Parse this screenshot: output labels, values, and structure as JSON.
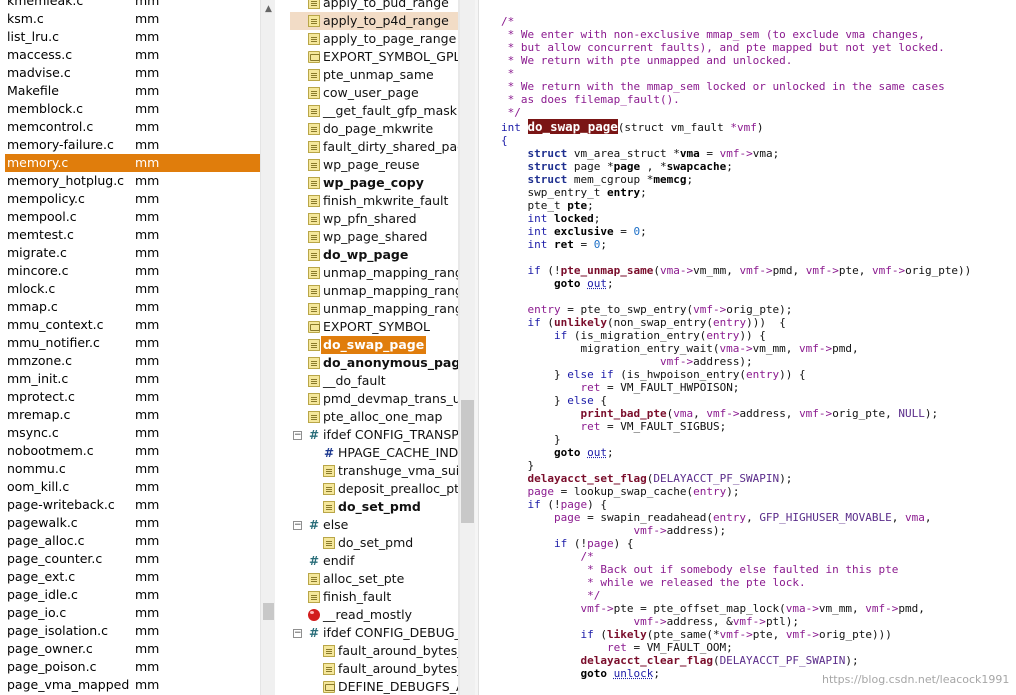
{
  "files": [
    {
      "name": "kmemleak.c",
      "dir": "mm",
      "partial": true
    },
    {
      "name": "ksm.c",
      "dir": "mm"
    },
    {
      "name": "list_lru.c",
      "dir": "mm"
    },
    {
      "name": "maccess.c",
      "dir": "mm"
    },
    {
      "name": "madvise.c",
      "dir": "mm"
    },
    {
      "name": "Makefile",
      "dir": "mm"
    },
    {
      "name": "memblock.c",
      "dir": "mm"
    },
    {
      "name": "memcontrol.c",
      "dir": "mm"
    },
    {
      "name": "memory-failure.c",
      "dir": "mm"
    },
    {
      "name": "memory.c",
      "dir": "mm",
      "selected": true
    },
    {
      "name": "memory_hotplug.c",
      "dir": "mm"
    },
    {
      "name": "mempolicy.c",
      "dir": "mm"
    },
    {
      "name": "mempool.c",
      "dir": "mm"
    },
    {
      "name": "memtest.c",
      "dir": "mm"
    },
    {
      "name": "migrate.c",
      "dir": "mm"
    },
    {
      "name": "mincore.c",
      "dir": "mm"
    },
    {
      "name": "mlock.c",
      "dir": "mm"
    },
    {
      "name": "mmap.c",
      "dir": "mm"
    },
    {
      "name": "mmu_context.c",
      "dir": "mm"
    },
    {
      "name": "mmu_notifier.c",
      "dir": "mm"
    },
    {
      "name": "mmzone.c",
      "dir": "mm"
    },
    {
      "name": "mm_init.c",
      "dir": "mm"
    },
    {
      "name": "mprotect.c",
      "dir": "mm"
    },
    {
      "name": "mremap.c",
      "dir": "mm"
    },
    {
      "name": "msync.c",
      "dir": "mm"
    },
    {
      "name": "nobootmem.c",
      "dir": "mm"
    },
    {
      "name": "nommu.c",
      "dir": "mm"
    },
    {
      "name": "oom_kill.c",
      "dir": "mm"
    },
    {
      "name": "page-writeback.c",
      "dir": "mm"
    },
    {
      "name": "pagewalk.c",
      "dir": "mm"
    },
    {
      "name": "page_alloc.c",
      "dir": "mm"
    },
    {
      "name": "page_counter.c",
      "dir": "mm"
    },
    {
      "name": "page_ext.c",
      "dir": "mm"
    },
    {
      "name": "page_idle.c",
      "dir": "mm"
    },
    {
      "name": "page_io.c",
      "dir": "mm"
    },
    {
      "name": "page_isolation.c",
      "dir": "mm"
    },
    {
      "name": "page_owner.c",
      "dir": "mm"
    },
    {
      "name": "page_poison.c",
      "dir": "mm"
    },
    {
      "name": "page_vma_mapped",
      "dir": "mm"
    }
  ],
  "symbols": [
    {
      "label": "apply_to_pud_range",
      "icon": "func",
      "indent": 0
    },
    {
      "label": "apply_to_p4d_range",
      "icon": "func",
      "indent": 0,
      "highlight": true
    },
    {
      "label": "apply_to_page_range",
      "icon": "func",
      "indent": 0
    },
    {
      "label": "EXPORT_SYMBOL_GPL",
      "icon": "export",
      "indent": 0
    },
    {
      "label": "pte_unmap_same",
      "icon": "func",
      "indent": 0
    },
    {
      "label": "cow_user_page",
      "icon": "func",
      "indent": 0
    },
    {
      "label": "__get_fault_gfp_mask",
      "icon": "func",
      "indent": 0
    },
    {
      "label": "do_page_mkwrite",
      "icon": "func",
      "indent": 0
    },
    {
      "label": "fault_dirty_shared_page",
      "icon": "func",
      "indent": 0
    },
    {
      "label": "wp_page_reuse",
      "icon": "func",
      "indent": 0
    },
    {
      "label": "wp_page_copy",
      "icon": "func",
      "indent": 0,
      "bold": true
    },
    {
      "label": "finish_mkwrite_fault",
      "icon": "func",
      "indent": 0
    },
    {
      "label": "wp_pfn_shared",
      "icon": "func",
      "indent": 0
    },
    {
      "label": "wp_page_shared",
      "icon": "func",
      "indent": 0
    },
    {
      "label": "do_wp_page",
      "icon": "func",
      "indent": 0,
      "bold": true
    },
    {
      "label": "unmap_mapping_range",
      "icon": "func",
      "indent": 0
    },
    {
      "label": "unmap_mapping_range",
      "icon": "func",
      "indent": 0
    },
    {
      "label": "unmap_mapping_range",
      "icon": "func",
      "indent": 0
    },
    {
      "label": "EXPORT_SYMBOL",
      "icon": "export",
      "indent": 0
    },
    {
      "label": "do_swap_page",
      "icon": "func",
      "indent": 0,
      "bold": true,
      "selected": true
    },
    {
      "label": "do_anonymous_page",
      "icon": "func",
      "indent": 0,
      "bold": true
    },
    {
      "label": "__do_fault",
      "icon": "func",
      "indent": 0
    },
    {
      "label": "pmd_devmap_trans_uns",
      "icon": "func",
      "indent": 0
    },
    {
      "label": "pte_alloc_one_map",
      "icon": "func",
      "indent": 0
    },
    {
      "label": "ifdef CONFIG_TRANSPA",
      "icon": "hash",
      "indent": 0,
      "toggle": "−"
    },
    {
      "label": "HPAGE_CACHE_INDE",
      "icon": "hashdark",
      "indent": 1
    },
    {
      "label": "transhuge_vma_suital",
      "icon": "func",
      "indent": 1
    },
    {
      "label": "deposit_prealloc_pte",
      "icon": "func",
      "indent": 1
    },
    {
      "label": "do_set_pmd",
      "icon": "func",
      "indent": 1,
      "bold": true
    },
    {
      "label": "else",
      "icon": "hash",
      "indent": 0,
      "toggle": "−"
    },
    {
      "label": "do_set_pmd",
      "icon": "func",
      "indent": 1
    },
    {
      "label": "endif",
      "icon": "hash",
      "indent": 0
    },
    {
      "label": "alloc_set_pte",
      "icon": "func",
      "indent": 0
    },
    {
      "label": "finish_fault",
      "icon": "func",
      "indent": 0
    },
    {
      "label": "__read_mostly",
      "icon": "red",
      "indent": 0
    },
    {
      "label": "ifdef CONFIG_DEBUG_F",
      "icon": "hash",
      "indent": 0,
      "toggle": "−"
    },
    {
      "label": "fault_around_bytes_g",
      "icon": "func",
      "indent": 1
    },
    {
      "label": "fault_around_bytes_s",
      "icon": "func",
      "indent": 1
    },
    {
      "label": "DEFINE_DEBUGFS_AT",
      "icon": "export",
      "indent": 1
    }
  ],
  "code": [
    [
      [
        "cm",
        "/*"
      ]
    ],
    [
      [
        "cm",
        " * We enter with non-exclusive mmap_sem (to exclude vma changes,"
      ]
    ],
    [
      [
        "cm",
        " * but allow concurrent faults), and pte mapped but not yet locked."
      ]
    ],
    [
      [
        "cm",
        " * We return with pte unmapped and unlocked."
      ]
    ],
    [
      [
        "cm",
        " *"
      ]
    ],
    [
      [
        "cm",
        " * We return with the mmap_sem locked or unlocked in the same cases"
      ]
    ],
    [
      [
        "cm",
        " * as does filemap_fault()."
      ]
    ],
    [
      [
        "cm",
        " */"
      ]
    ],
    [
      [
        "kw",
        "int "
      ],
      [
        "fnhl",
        "do_swap_page"
      ],
      [
        "",
        "(struct vm_fault "
      ],
      [
        "var",
        "*vmf"
      ],
      [
        "",
        ")"
      ]
    ],
    [
      [
        "kw",
        "{"
      ]
    ],
    [
      [
        "",
        "    "
      ],
      [
        "ty",
        "struct"
      ],
      [
        "",
        " vm_area_struct *"
      ],
      [
        "bk",
        "vma"
      ],
      [
        "",
        " = "
      ],
      [
        "var",
        "vmf->"
      ],
      [
        "",
        "vma;"
      ]
    ],
    [
      [
        "",
        "    "
      ],
      [
        "ty",
        "struct"
      ],
      [
        "",
        " page *"
      ],
      [
        "bk",
        "page"
      ],
      [
        "",
        " , *"
      ],
      [
        "bk",
        "swapcache"
      ],
      [
        "",
        ";"
      ]
    ],
    [
      [
        "",
        "    "
      ],
      [
        "ty",
        "struct"
      ],
      [
        "",
        " mem_cgroup *"
      ],
      [
        "bk",
        "memcg"
      ],
      [
        "",
        ";"
      ]
    ],
    [
      [
        "",
        "    swp_entry_t "
      ],
      [
        "bk",
        "entry"
      ],
      [
        "",
        ";"
      ]
    ],
    [
      [
        "",
        "    pte_t "
      ],
      [
        "bk",
        "pte"
      ],
      [
        "",
        ";"
      ]
    ],
    [
      [
        "",
        "    "
      ],
      [
        "kw",
        "int "
      ],
      [
        "bk",
        "locked"
      ],
      [
        "",
        ";"
      ]
    ],
    [
      [
        "",
        "    "
      ],
      [
        "kw",
        "int "
      ],
      [
        "bk",
        "exclusive"
      ],
      [
        "",
        " = "
      ],
      [
        "num",
        "0"
      ],
      [
        "",
        ";"
      ]
    ],
    [
      [
        "",
        "    "
      ],
      [
        "kw",
        "int "
      ],
      [
        "bk",
        "ret"
      ],
      [
        "",
        " = "
      ],
      [
        "num",
        "0"
      ],
      [
        "",
        ";"
      ]
    ],
    [
      [
        "",
        ""
      ]
    ],
    [
      [
        "",
        "    "
      ],
      [
        "kw",
        "if"
      ],
      [
        "",
        " (!"
      ],
      [
        "fn2",
        "pte_unmap_same"
      ],
      [
        "",
        "("
      ],
      [
        "var",
        "vma->"
      ],
      [
        "",
        "vm_mm, "
      ],
      [
        "var",
        "vmf->"
      ],
      [
        "",
        "pmd, "
      ],
      [
        "var",
        "vmf->"
      ],
      [
        "",
        "pte, "
      ],
      [
        "var",
        "vmf->"
      ],
      [
        "",
        "orig_pte))"
      ]
    ],
    [
      [
        "",
        "        "
      ],
      [
        "bk",
        "goto"
      ],
      [
        "kw",
        " "
      ],
      [
        "loc",
        "out"
      ],
      [
        "",
        ";"
      ]
    ],
    [
      [
        "",
        ""
      ]
    ],
    [
      [
        "",
        "    "
      ],
      [
        "var",
        "entry"
      ],
      [
        "",
        " = pte_to_swp_entry("
      ],
      [
        "var",
        "vmf->"
      ],
      [
        "",
        "orig_pte);"
      ]
    ],
    [
      [
        "",
        "    "
      ],
      [
        "kw",
        "if"
      ],
      [
        "",
        " ("
      ],
      [
        "fn2",
        "unlikely"
      ],
      [
        "",
        "(non_swap_entry("
      ],
      [
        "var",
        "entry"
      ],
      [
        "",
        ")))  {"
      ]
    ],
    [
      [
        "",
        "        "
      ],
      [
        "kw",
        "if"
      ],
      [
        "",
        " (is_migration_entry("
      ],
      [
        "var",
        "entry"
      ],
      [
        "",
        ")) {"
      ]
    ],
    [
      [
        "",
        "            migration_entry_wait("
      ],
      [
        "var",
        "vma->"
      ],
      [
        "",
        "vm_mm, "
      ],
      [
        "var",
        "vmf->"
      ],
      [
        "",
        "pmd,"
      ]
    ],
    [
      [
        "",
        "                        "
      ],
      [
        "var",
        "vmf->"
      ],
      [
        "",
        "address);"
      ]
    ],
    [
      [
        "",
        "        } "
      ],
      [
        "kw",
        "else if"
      ],
      [
        "",
        " (is_hwpoison_entry("
      ],
      [
        "var",
        "entry"
      ],
      [
        "",
        ")) {"
      ]
    ],
    [
      [
        "",
        "            "
      ],
      [
        "var",
        "ret"
      ],
      [
        "",
        " = VM_FAULT_HWPOISON;"
      ]
    ],
    [
      [
        "",
        "        } "
      ],
      [
        "kw",
        "else"
      ],
      [
        "",
        " {"
      ]
    ],
    [
      [
        "",
        "            "
      ],
      [
        "fn2",
        "print_bad_pte"
      ],
      [
        "",
        "("
      ],
      [
        "var",
        "vma"
      ],
      [
        "",
        ", "
      ],
      [
        "var",
        "vmf->"
      ],
      [
        "",
        "address, "
      ],
      [
        "var",
        "vmf->"
      ],
      [
        "",
        "orig_pte, "
      ],
      [
        "mac",
        "NULL"
      ],
      [
        "",
        ");"
      ]
    ],
    [
      [
        "",
        "            "
      ],
      [
        "var",
        "ret"
      ],
      [
        "",
        " = VM_FAULT_SIGBUS;"
      ]
    ],
    [
      [
        "",
        "        }"
      ]
    ],
    [
      [
        "",
        "        "
      ],
      [
        "bk",
        "goto"
      ],
      [
        "kw",
        " "
      ],
      [
        "loc",
        "out"
      ],
      [
        "",
        ";"
      ]
    ],
    [
      [
        "",
        "    }"
      ]
    ],
    [
      [
        "",
        "    "
      ],
      [
        "fn2",
        "delayacct_set_flag"
      ],
      [
        "",
        "("
      ],
      [
        "mac",
        "DELAYACCT_PF_SWAPIN"
      ],
      [
        "",
        ");"
      ]
    ],
    [
      [
        "",
        "    "
      ],
      [
        "var",
        "page"
      ],
      [
        "",
        " = lookup_swap_cache("
      ],
      [
        "var",
        "entry"
      ],
      [
        "",
        ");"
      ]
    ],
    [
      [
        "",
        "    "
      ],
      [
        "kw",
        "if"
      ],
      [
        "",
        " (!"
      ],
      [
        "var",
        "page"
      ],
      [
        "",
        ") {"
      ]
    ],
    [
      [
        "",
        "        "
      ],
      [
        "var",
        "page"
      ],
      [
        "",
        " = swapin_readahead("
      ],
      [
        "var",
        "entry"
      ],
      [
        "",
        ", "
      ],
      [
        "mac",
        "GFP_HIGHUSER_MOVABLE"
      ],
      [
        "",
        ", "
      ],
      [
        "var",
        "vma"
      ],
      [
        "",
        ","
      ]
    ],
    [
      [
        "",
        "                    "
      ],
      [
        "var",
        "vmf->"
      ],
      [
        "",
        "address);"
      ]
    ],
    [
      [
        "",
        "        "
      ],
      [
        "kw",
        "if"
      ],
      [
        "",
        " (!"
      ],
      [
        "var",
        "page"
      ],
      [
        "",
        ") {"
      ]
    ],
    [
      [
        "",
        "            "
      ],
      [
        "cm",
        "/*"
      ]
    ],
    [
      [
        "",
        "            "
      ],
      [
        "cm",
        " * Back out if somebody else faulted in this pte"
      ]
    ],
    [
      [
        "",
        "            "
      ],
      [
        "cm",
        " * while we released the pte lock."
      ]
    ],
    [
      [
        "",
        "            "
      ],
      [
        "cm",
        " */"
      ]
    ],
    [
      [
        "",
        "            "
      ],
      [
        "var",
        "vmf->"
      ],
      [
        "",
        "pte = pte_offset_map_lock("
      ],
      [
        "var",
        "vma->"
      ],
      [
        "",
        "vm_mm, "
      ],
      [
        "var",
        "vmf->"
      ],
      [
        "",
        "pmd,"
      ]
    ],
    [
      [
        "",
        "                    "
      ],
      [
        "var",
        "vmf->"
      ],
      [
        "",
        "address, &"
      ],
      [
        "var",
        "vmf->"
      ],
      [
        "",
        "ptl);"
      ]
    ],
    [
      [
        "",
        "            "
      ],
      [
        "kw",
        "if"
      ],
      [
        "",
        " ("
      ],
      [
        "fn2",
        "likely"
      ],
      [
        "",
        "(pte_same(*"
      ],
      [
        "var",
        "vmf->"
      ],
      [
        "",
        "pte, "
      ],
      [
        "var",
        "vmf->"
      ],
      [
        "",
        "orig_pte)))"
      ]
    ],
    [
      [
        "",
        "                "
      ],
      [
        "var",
        "ret"
      ],
      [
        "",
        " = VM_FAULT_OOM;"
      ]
    ],
    [
      [
        "",
        "            "
      ],
      [
        "fn2",
        "delayacct_clear_flag"
      ],
      [
        "",
        "("
      ],
      [
        "mac",
        "DELAYACCT_PF_SWAPIN"
      ],
      [
        "",
        ");"
      ]
    ],
    [
      [
        "",
        "            "
      ],
      [
        "bk",
        "goto"
      ],
      [
        "kw",
        " "
      ],
      [
        "loc",
        "unlock"
      ],
      [
        "",
        ";"
      ]
    ]
  ],
  "watermark": "https://blog.csdn.net/leacock1991"
}
